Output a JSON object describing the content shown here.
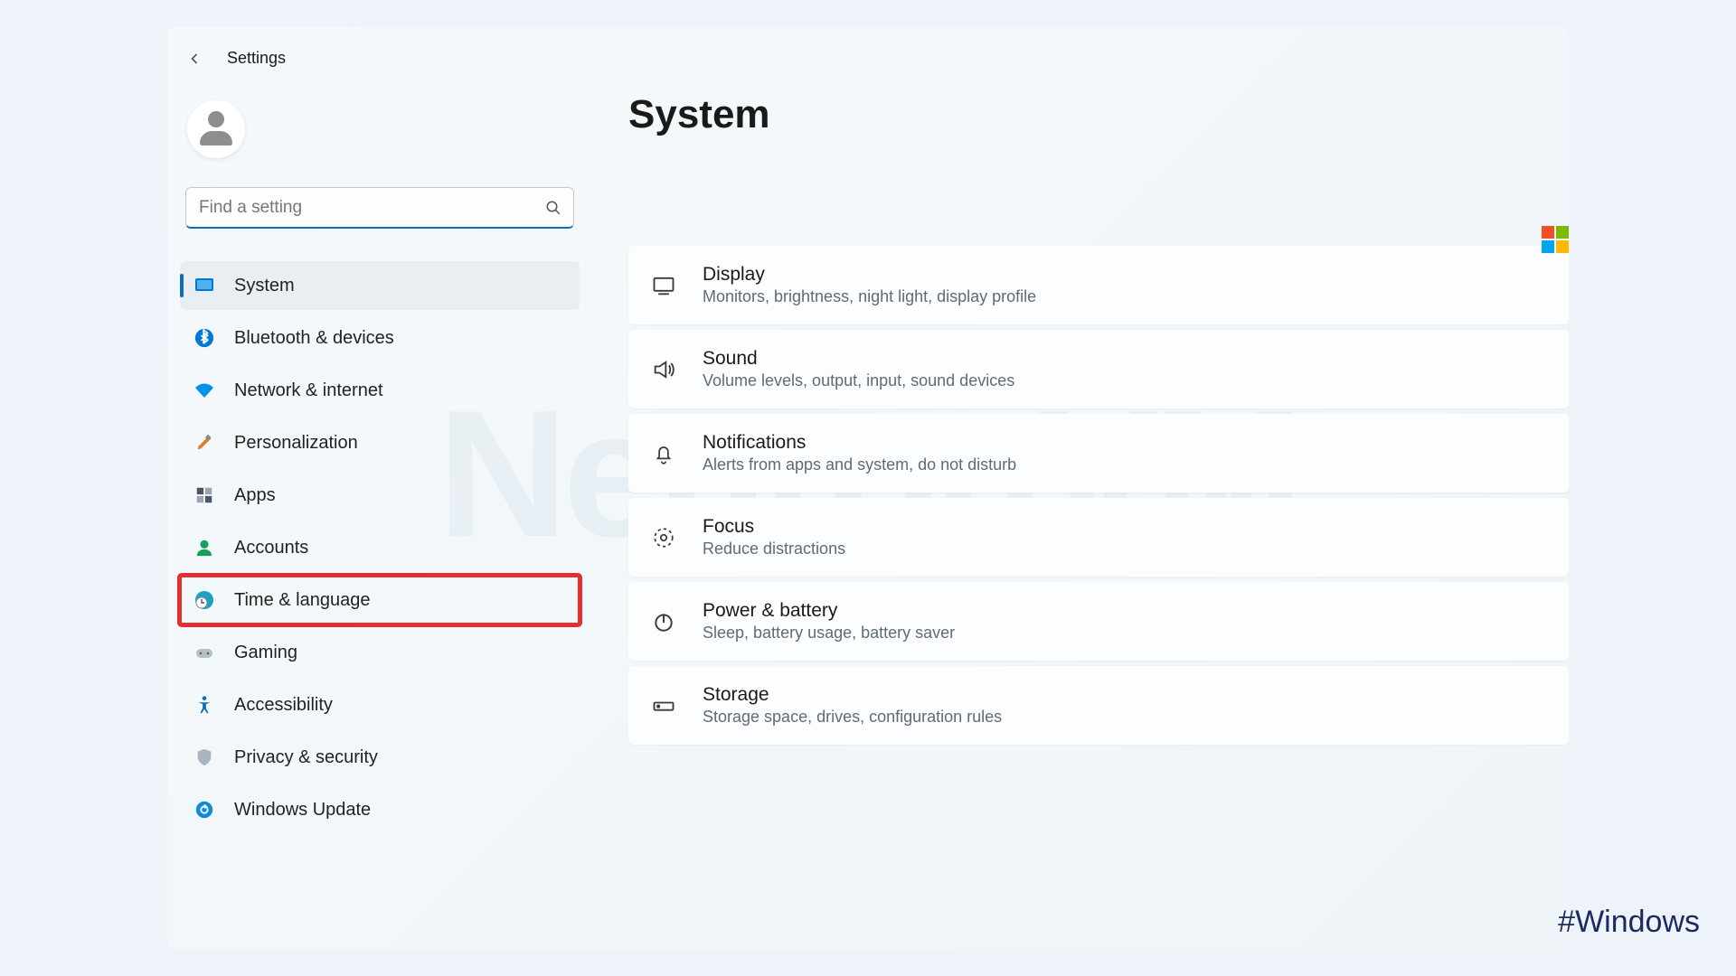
{
  "header": {
    "app_title": "Settings"
  },
  "search": {
    "placeholder": "Find a setting"
  },
  "sidebar": {
    "items": [
      {
        "label": "System",
        "selected": true,
        "icon": "system-icon"
      },
      {
        "label": "Bluetooth & devices",
        "icon": "bluetooth-icon"
      },
      {
        "label": "Network & internet",
        "icon": "wifi-icon"
      },
      {
        "label": "Personalization",
        "icon": "brush-icon"
      },
      {
        "label": "Apps",
        "icon": "apps-icon"
      },
      {
        "label": "Accounts",
        "icon": "person-icon"
      },
      {
        "label": "Time & language",
        "icon": "clock-globe-icon",
        "highlighted": true
      },
      {
        "label": "Gaming",
        "icon": "gamepad-icon"
      },
      {
        "label": "Accessibility",
        "icon": "accessibility-icon"
      },
      {
        "label": "Privacy & security",
        "icon": "shield-icon"
      },
      {
        "label": "Windows Update",
        "icon": "update-icon"
      }
    ]
  },
  "main": {
    "page_title": "System",
    "cards": [
      {
        "title": "Display",
        "subtitle": "Monitors, brightness, night light, display profile",
        "icon": "monitor-icon"
      },
      {
        "title": "Sound",
        "subtitle": "Volume levels, output, input, sound devices",
        "icon": "speaker-icon"
      },
      {
        "title": "Notifications",
        "subtitle": "Alerts from apps and system, do not disturb",
        "icon": "bell-icon"
      },
      {
        "title": "Focus",
        "subtitle": "Reduce distractions",
        "icon": "focus-icon"
      },
      {
        "title": "Power & battery",
        "subtitle": "Sleep, battery usage, battery saver",
        "icon": "power-icon"
      },
      {
        "title": "Storage",
        "subtitle": "Storage space, drives, configuration rules",
        "icon": "storage-icon"
      }
    ]
  },
  "overlay": {
    "watermark": "NeuronVM",
    "hashtag": "#Windows"
  }
}
